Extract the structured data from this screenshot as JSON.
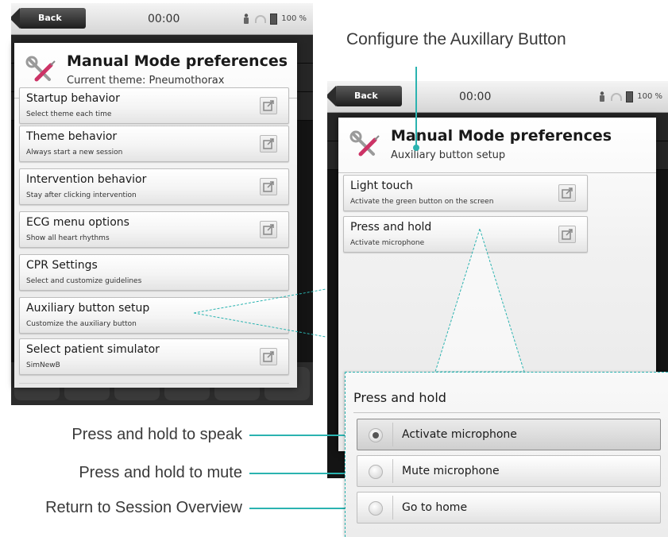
{
  "annotations": {
    "top": "Configure the Auxillary Button",
    "speak": "Press and hold to speak",
    "mute": "Press and hold to mute",
    "home": "Return to Session Overview"
  },
  "statusbar": {
    "back": "Back",
    "clock": "00:00",
    "battery": "100 %"
  },
  "left_dialog": {
    "title": "Manual Mode preferences",
    "subtitle": "Current theme: Pneumothorax",
    "items": [
      {
        "title": "Startup behavior",
        "desc": "Select theme each time"
      },
      {
        "title": "Theme behavior",
        "desc": "Always start a new session"
      },
      {
        "title": "Intervention behavior",
        "desc": "Stay after clicking intervention"
      },
      {
        "title": "ECG menu options",
        "desc": "Show all heart rhythms"
      },
      {
        "title": "CPR Settings",
        "desc": "Select and customize guidelines"
      },
      {
        "title": "Auxiliary button setup",
        "desc": "Customize the auxiliary button"
      },
      {
        "title": "Select patient simulator",
        "desc": "SimNewB"
      }
    ]
  },
  "right_dialog": {
    "title": "Manual Mode preferences",
    "subtitle": "Auxiliary button setup",
    "items": [
      {
        "title": "Light touch",
        "desc": "Activate the green button on the screen"
      },
      {
        "title": "Press and hold",
        "desc": "Activate microphone"
      }
    ]
  },
  "zoom_panel": {
    "title": "Press and hold",
    "options": [
      {
        "label": "Activate microphone",
        "selected": true
      },
      {
        "label": "Mute microphone",
        "selected": false
      },
      {
        "label": "Go to home",
        "selected": false
      }
    ]
  },
  "colors": {
    "annotation_line": "#2bb3b0",
    "dialog_bg": "#f1f1f1",
    "backdrop": "#141414"
  },
  "icons": [
    "tools-icon",
    "external-link-icon",
    "person-icon",
    "wifi-icon",
    "battery-icon",
    "back-arrow-icon"
  ]
}
